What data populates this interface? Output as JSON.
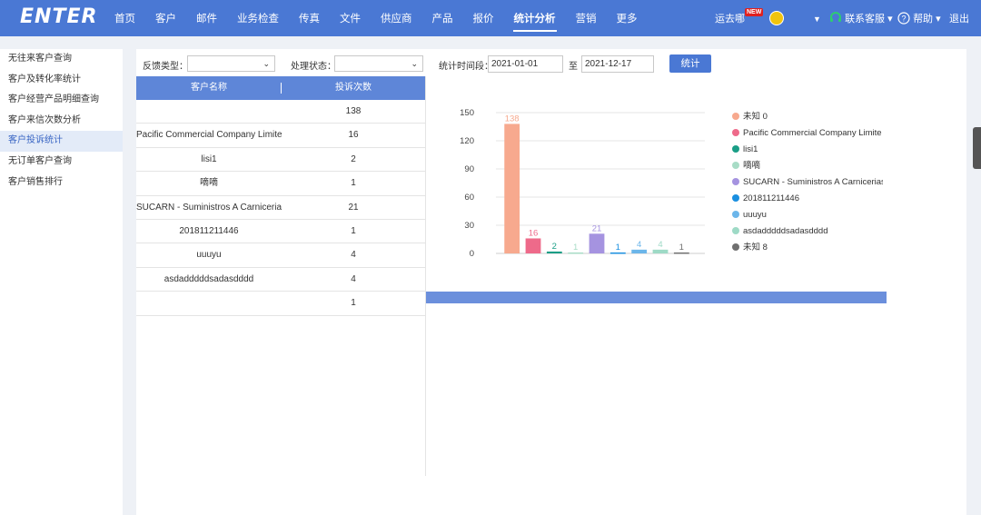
{
  "header": {
    "logo": "ENTER",
    "nav": [
      "首页",
      "客户",
      "邮件",
      "业务检查",
      "传真",
      "文件",
      "供应商",
      "产品",
      "报价",
      "统计分析",
      "营销",
      "更多"
    ],
    "active_nav": "统计分析",
    "user": "运去哪",
    "new_badge": "NEW",
    "contact": "联系客服",
    "help": "帮助",
    "logout": "退出"
  },
  "sidebar": {
    "items": [
      "无往来客户查询",
      "客户及转化率统计",
      "客户经营产品明细查询",
      "客户来信次数分析",
      "客户投诉统计",
      "无订单客户查询",
      "客户销售排行"
    ],
    "active_index": 4
  },
  "filters": {
    "feedback_type_label": "反馈类型：",
    "feedback_type_value": "",
    "status_label": "处理状态：",
    "status_value": "",
    "period_label": "统计时间段：",
    "start_date": "2021-01-01",
    "to": "至",
    "end_date": "2021-12-17",
    "submit": "统计"
  },
  "table": {
    "headers": [
      "客户名称",
      "投诉次数"
    ],
    "rows": [
      [
        "",
        "138"
      ],
      [
        "Pacific Commercial Company Limited",
        "16"
      ],
      [
        "lisi1",
        "2"
      ],
      [
        "嘀嘀",
        "1"
      ],
      [
        "SUCARN - Suministros A Carnicerias",
        "21"
      ],
      [
        "201811211446",
        "1"
      ],
      [
        "uuuyu",
        "4"
      ],
      [
        "asdadddddsadasdddd",
        "4"
      ],
      [
        "",
        "1"
      ]
    ]
  },
  "chart_data": {
    "type": "bar",
    "categories": [
      "未知 0",
      "Pacific Commercial Company Limite",
      "lisi1",
      "嘀嘀",
      "SUCARN - Suministros A Carnicerias",
      "201811211446",
      "uuuyu",
      "asdadddddsadasdddd",
      "未知 8"
    ],
    "values": [
      138,
      16,
      2,
      1,
      21,
      1,
      4,
      4,
      1
    ],
    "colors": [
      "#f7a98e",
      "#ee6a8a",
      "#1a9e86",
      "#a8dcc6",
      "#a593e0",
      "#1a8fe0",
      "#6cb6ea",
      "#9edac6",
      "#707070"
    ],
    "ylim": [
      0,
      150
    ],
    "yticks": [
      0,
      30,
      60,
      90,
      120,
      150
    ],
    "legend": "right",
    "grid": true
  }
}
